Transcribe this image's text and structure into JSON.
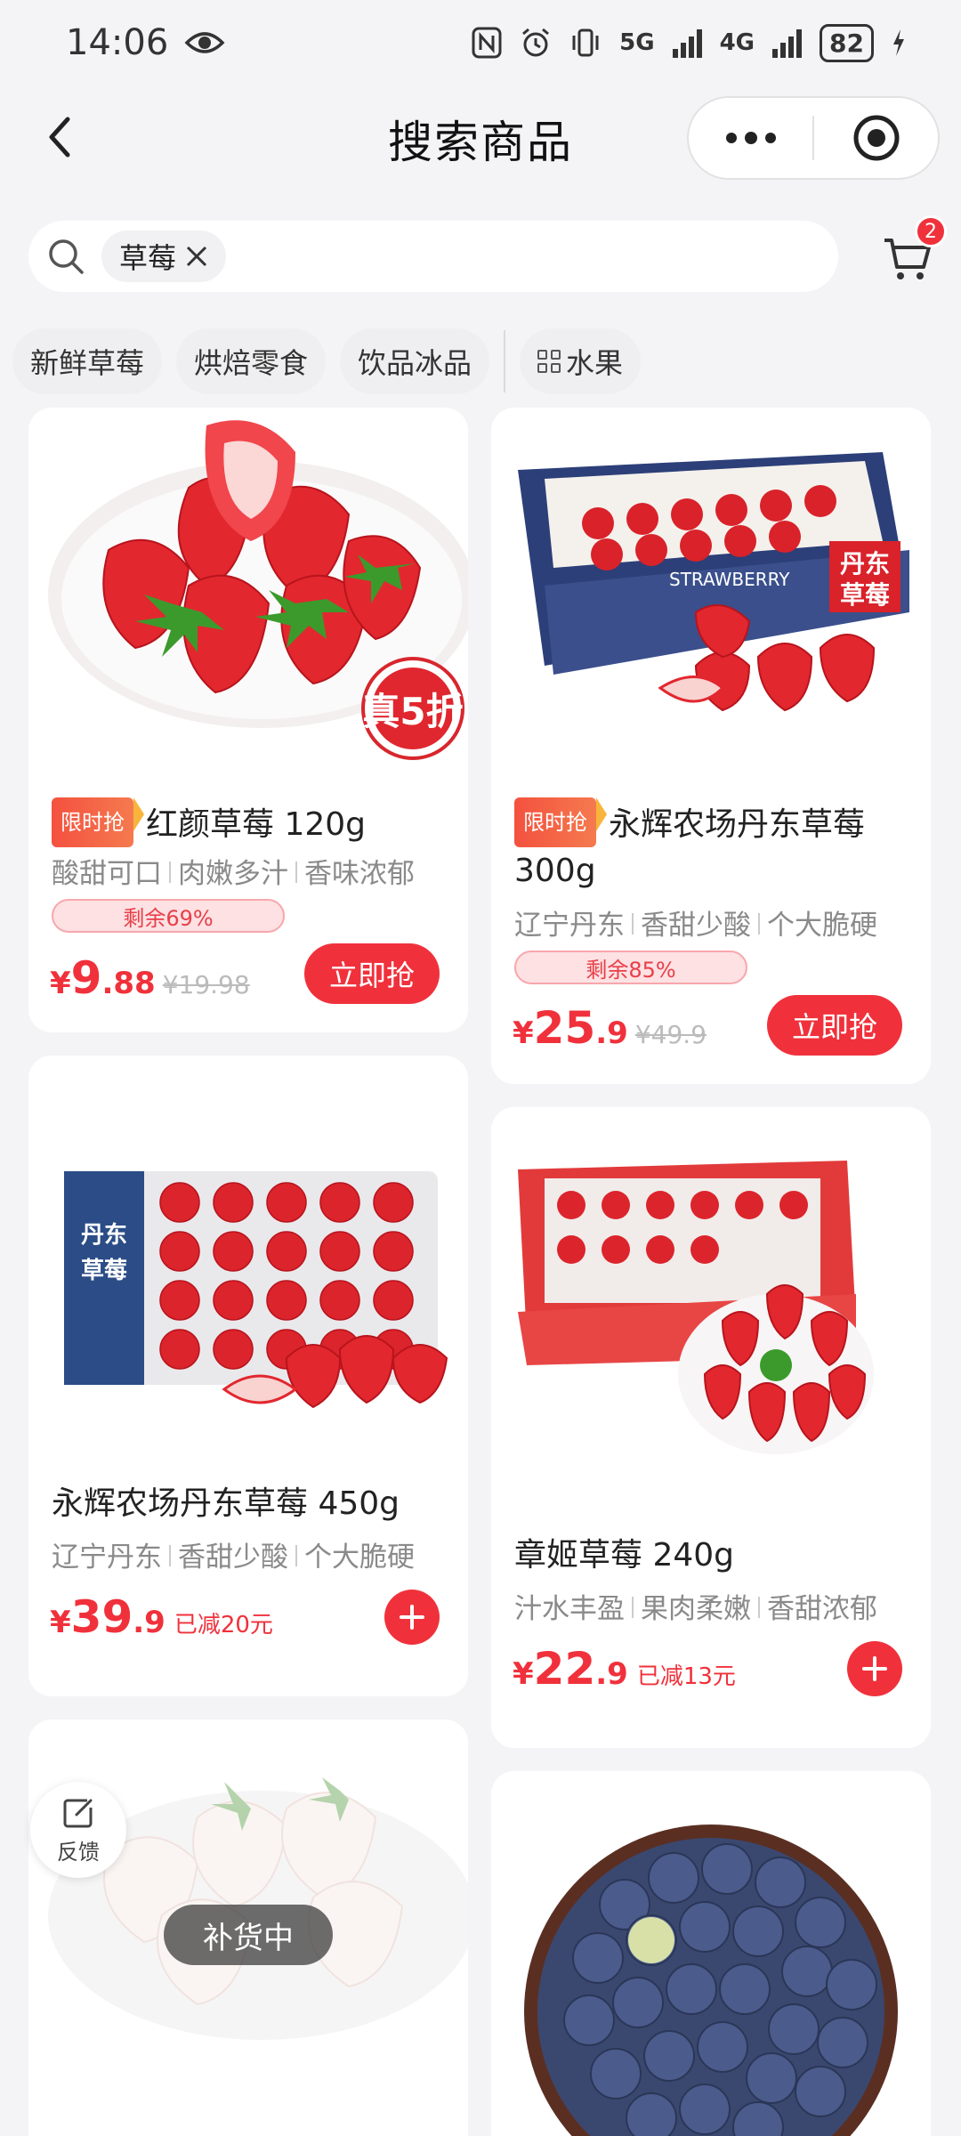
{
  "status_bar": {
    "time": "14:06",
    "battery": "82",
    "net1": "5G",
    "net2": "4G"
  },
  "nav": {
    "title": "搜索商品"
  },
  "search": {
    "keyword": "草莓",
    "cart_count": "2"
  },
  "categories": [
    {
      "label": "新鲜草莓"
    },
    {
      "label": "烘焙零食"
    },
    {
      "label": "饮品冰品"
    },
    {
      "label": "水果"
    }
  ],
  "products": [
    {
      "tag": "限时抢",
      "title": "红颜草莓 120g",
      "f1": "酸甜可口",
      "f2": "肉嫩多汁",
      "f3": "香味浓郁",
      "remain": "剩余69%",
      "remain_pct": 69,
      "cur": "¥",
      "int": "9",
      "dec": ".88",
      "orig": "¥19.98",
      "button": "立即抢",
      "promo_sticker": "真5折"
    },
    {
      "tag": "限时抢",
      "title": "永辉农场丹东草莓 300g",
      "f1": "辽宁丹东",
      "f2": "香甜少酸",
      "f3": "个大脆硬",
      "remain": "剩余85%",
      "remain_pct": 85,
      "cur": "¥",
      "int": "25",
      "dec": ".9",
      "orig": "¥49.9",
      "button": "立即抢"
    },
    {
      "title": "永辉农场丹东草莓 450g",
      "f1": "辽宁丹东",
      "f2": "香甜少酸",
      "f3": "个大脆硬",
      "cur": "¥",
      "int": "39",
      "dec": ".9",
      "off": "已减20元"
    },
    {
      "title": "章姬草莓 240g",
      "f1": "汁水丰盈",
      "f2": "果肉柔嫩",
      "f3": "香甜浓郁",
      "cur": "¥",
      "int": "22",
      "dec": ".9",
      "off": "已减13元"
    }
  ],
  "overlay": {
    "feedback": "反馈",
    "restock": "补货中"
  },
  "colors": {
    "accent": "#f0313b",
    "background": "#f4f4f6"
  }
}
